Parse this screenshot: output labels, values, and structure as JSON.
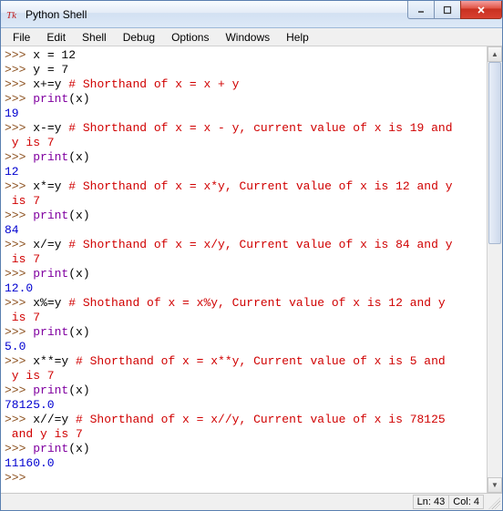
{
  "window": {
    "title": "Python Shell"
  },
  "menubar": [
    "File",
    "Edit",
    "Shell",
    "Debug",
    "Options",
    "Windows",
    "Help"
  ],
  "status": {
    "line": "Ln: 43",
    "col": "Col: 4"
  },
  "lines": [
    [
      [
        "p",
        ">>> "
      ],
      [
        "k",
        "x = 12"
      ]
    ],
    [
      [
        "p",
        ">>> "
      ],
      [
        "k",
        "y = 7"
      ]
    ],
    [
      [
        "p",
        ">>> "
      ],
      [
        "k",
        "x+=y "
      ],
      [
        "c",
        "# Shorthand of x = x + y"
      ]
    ],
    [
      [
        "p",
        ">>> "
      ],
      [
        "fn",
        "print"
      ],
      [
        "k",
        "(x)"
      ]
    ],
    [
      [
        "o",
        "19"
      ]
    ],
    [
      [
        "p",
        ">>> "
      ],
      [
        "k",
        "x-=y "
      ],
      [
        "c",
        "# Shorthand of x = x - y, current value of x is 19 and"
      ]
    ],
    [
      [
        "c",
        " y is 7"
      ]
    ],
    [
      [
        "p",
        ">>> "
      ],
      [
        "fn",
        "print"
      ],
      [
        "k",
        "(x)"
      ]
    ],
    [
      [
        "o",
        "12"
      ]
    ],
    [
      [
        "p",
        ">>> "
      ],
      [
        "k",
        "x*=y "
      ],
      [
        "c",
        "# Shorthand of x = x*y, Current value of x is 12 and y"
      ]
    ],
    [
      [
        "c",
        " is 7"
      ]
    ],
    [
      [
        "p",
        ">>> "
      ],
      [
        "fn",
        "print"
      ],
      [
        "k",
        "(x)"
      ]
    ],
    [
      [
        "o",
        "84"
      ]
    ],
    [
      [
        "p",
        ">>> "
      ],
      [
        "k",
        "x/=y "
      ],
      [
        "c",
        "# Shorthand of x = x/y, Current value of x is 84 and y"
      ]
    ],
    [
      [
        "c",
        " is 7"
      ]
    ],
    [
      [
        "p",
        ">>> "
      ],
      [
        "fn",
        "print"
      ],
      [
        "k",
        "(x)"
      ]
    ],
    [
      [
        "o",
        "12.0"
      ]
    ],
    [
      [
        "p",
        ">>> "
      ],
      [
        "k",
        "x%=y "
      ],
      [
        "c",
        "# Shothand of x = x%y, Current value of x is 12 and y"
      ]
    ],
    [
      [
        "c",
        " is 7"
      ]
    ],
    [
      [
        "p",
        ">>> "
      ],
      [
        "fn",
        "print"
      ],
      [
        "k",
        "(x)"
      ]
    ],
    [
      [
        "o",
        "5.0"
      ]
    ],
    [
      [
        "p",
        ">>> "
      ],
      [
        "k",
        "x**=y "
      ],
      [
        "c",
        "# Shorthand of x = x**y, Current value of x is 5 and"
      ]
    ],
    [
      [
        "c",
        " y is 7"
      ]
    ],
    [
      [
        "p",
        ">>> "
      ],
      [
        "fn",
        "print"
      ],
      [
        "k",
        "(x)"
      ]
    ],
    [
      [
        "o",
        "78125.0"
      ]
    ],
    [
      [
        "p",
        ">>> "
      ],
      [
        "k",
        "x//=y "
      ],
      [
        "c",
        "# Shorthand of x = x//y, Current value of x is 78125"
      ]
    ],
    [
      [
        "c",
        " and y is 7"
      ]
    ],
    [
      [
        "p",
        ">>> "
      ],
      [
        "fn",
        "print"
      ],
      [
        "k",
        "(x)"
      ]
    ],
    [
      [
        "o",
        "11160.0"
      ]
    ],
    [
      [
        "p",
        ">>> "
      ]
    ]
  ]
}
